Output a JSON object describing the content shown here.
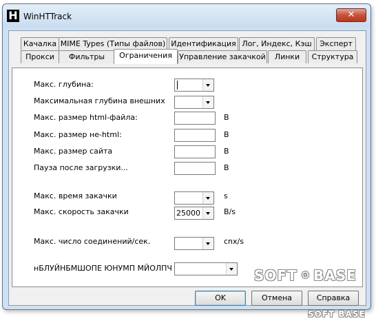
{
  "window": {
    "title": "WinHTTrack",
    "close_glyph": "✕",
    "app_icon": "H"
  },
  "tabs_row1": [
    "Качалка",
    "MIME Types (Типы файлов)",
    "Идентификация",
    "Лог, Индекс, Кэш",
    "Эксперт"
  ],
  "tabs_row2": [
    "Прокси",
    "Фильтры",
    "Ограничения",
    "Управление закачкой",
    "Линки",
    "Структура"
  ],
  "active_tab": "Ограничения",
  "form": {
    "max_depth": {
      "label": "Макс. глубина:",
      "value": ""
    },
    "max_ext_depth": {
      "label": "Максимальная глубина внешних",
      "value": ""
    },
    "max_html_size": {
      "label": "Макс. размер html-файла:",
      "value": "",
      "unit": "B"
    },
    "max_nonhtml_size": {
      "label": "Макс. размер не-html:",
      "value": "",
      "unit": "B"
    },
    "max_site_size": {
      "label": "Макс. размер сайта",
      "value": "",
      "unit": "B"
    },
    "pause_after": {
      "label": "Пауза после загрузки...",
      "value": "",
      "unit": "B"
    },
    "max_time": {
      "label": "Макс. время закачки",
      "value": "",
      "unit": "s"
    },
    "max_rate": {
      "label": "Макс. скорость закачки",
      "value": "25000",
      "unit": "B/s"
    },
    "max_conn": {
      "label": "Макс. число соединений/сек.",
      "value": "",
      "unit": "cnx/s"
    },
    "garbled": {
      "label": "нБЛУЙНБМШОПЕ ЮНУМП МЙОЛПЧ",
      "value": ""
    }
  },
  "buttons": {
    "ok": "OK",
    "cancel": "Отмена",
    "help": "Справка"
  },
  "watermark": {
    "main_left": "SOFT",
    "main_right": "BASE",
    "footer": "SOFT BASE"
  }
}
